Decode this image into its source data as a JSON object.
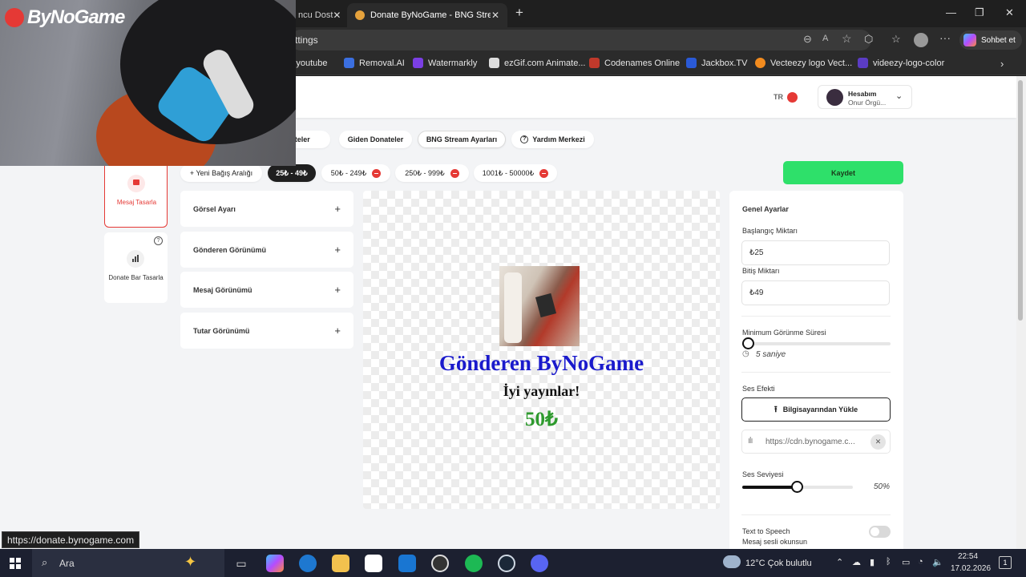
{
  "browser": {
    "tabs": [
      {
        "label": "ncu Dost",
        "active": false
      },
      {
        "label": "Donate ByNoGame - BNG Stream A",
        "active": true
      }
    ],
    "address_text": "ttings",
    "sidebar_chat_label": "Sohbet et",
    "bookmarks": [
      {
        "label": "Syoutube",
        "icon_color": "#ff0000"
      },
      {
        "label": "Removal.AI",
        "icon_color": "#3b6fe0"
      },
      {
        "label": "Watermarkly",
        "icon_color": "#7b3fe4"
      },
      {
        "label": "ezGif.com Animate...",
        "icon_color": "#dddddd"
      },
      {
        "label": "Codenames Online",
        "icon_color": "#c0392b"
      },
      {
        "label": "Jackbox.TV",
        "icon_color": "#2a5ad7"
      },
      {
        "label": "Vecteezy logo Vect...",
        "icon_color": "#f28b1e"
      },
      {
        "label": "videezy-logo-color",
        "icon_color": "#5b3cc4"
      }
    ],
    "status_url": "https://donate.bynogame.com"
  },
  "overlay": {
    "logo_text": "ByNoGame"
  },
  "header": {
    "lang": "TR",
    "account_title": "Hesabım",
    "account_name": "Onur Örgü..."
  },
  "top_tabs": [
    {
      "label": "Donateler"
    },
    {
      "label": "Giden Donateler"
    },
    {
      "label": "BNG Stream Ayarları"
    },
    {
      "label": "Yardım Merkezi"
    }
  ],
  "left_nav": [
    {
      "label": "Mesaj Tasarla",
      "active": true
    },
    {
      "label": "Donate Bar Tasarla",
      "active": false
    }
  ],
  "ranges": {
    "add_label": "+ Yeni Bağış Aralığı",
    "items": [
      "25₺ - 49₺",
      "50₺ - 249₺",
      "250₺ - 999₺",
      "1001₺ - 50000₺"
    ],
    "selected_index": 0
  },
  "save_label": "Kaydet",
  "accordions": [
    "Görsel Ayarı",
    "Gönderen Görünümü",
    "Mesaj Görünümü",
    "Tutar Görünümü"
  ],
  "preview": {
    "sender": "Gönderen ByNoGame",
    "message": "İyi yayınlar!",
    "amount": "50₺",
    "sender_color": "#1a1acc",
    "amount_color": "#2e9a2e"
  },
  "settings": {
    "title": "Genel Ayarlar",
    "start_label": "Başlangıç Miktarı",
    "start_value": "₺25",
    "end_label": "Bitiş Miktarı",
    "end_value": "₺49",
    "min_duration_label": "Minimum Görünme Süresi",
    "min_duration_value": "5 saniye",
    "min_duration_fraction": 0.03,
    "sound_label": "Ses Efekti",
    "upload_label": "Bilgisayarından Yükle",
    "sound_url": "https://cdn.bynogame.c...",
    "volume_label": "Ses Seviyesi",
    "volume_value": "50%",
    "volume_fraction": 0.5,
    "tts_label": "Text to Speech",
    "tts_sub": "Mesaj sesli okunsun",
    "tts_enabled": false
  },
  "taskbar": {
    "search_label": "Ara",
    "weather": "12°C  Çok bulutlu",
    "time": "22:54",
    "date": "17.02.2026",
    "notifications": "1"
  },
  "colors": {
    "accent_green": "#2ee06a",
    "active_red": "#e53935"
  }
}
